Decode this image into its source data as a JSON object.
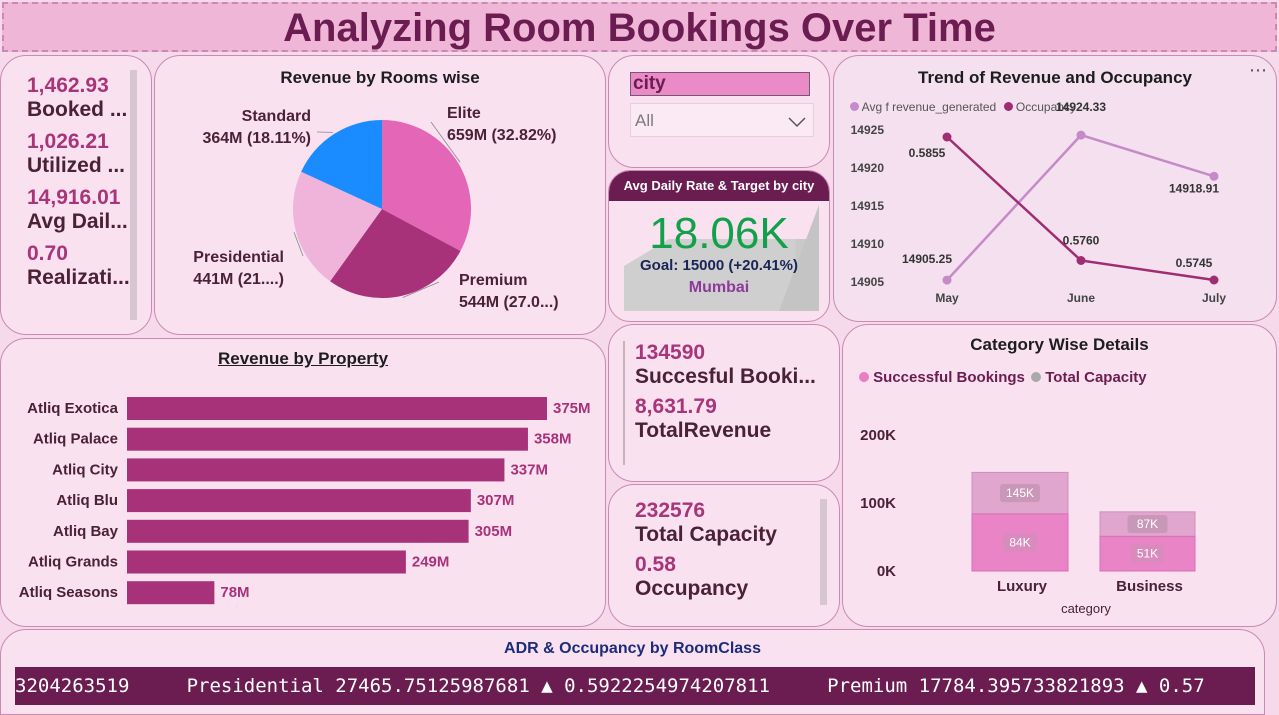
{
  "header": {
    "title": "Analyzing Room Bookings Over Time"
  },
  "kpis_left": [
    {
      "value": "1,462.93",
      "label": "Booked ..."
    },
    {
      "value": "1,026.21",
      "label": "Utilized ..."
    },
    {
      "value": "14,916.01",
      "label": "Avg Dail..."
    },
    {
      "value": "0.70",
      "label": "Realizati..."
    }
  ],
  "rooms_chart": {
    "title": "Revenue by Rooms wise",
    "slices": [
      {
        "name": "Elite",
        "value_label": "659M (32.82%)",
        "value": 659,
        "color": "#e466b7"
      },
      {
        "name": "Premium",
        "value_label": "544M (27.0...)",
        "value": 544,
        "color": "#a8327a"
      },
      {
        "name": "Presidential",
        "value_label": "441M (21....)",
        "value": 441,
        "color": "#f0b4da"
      },
      {
        "name": "Standard",
        "value_label": "364M (18.11%)",
        "value": 364,
        "color": "#1a8cff"
      }
    ]
  },
  "city_filter": {
    "label": "city",
    "selected": "All"
  },
  "gauge": {
    "title": "Avg Daily Rate & Target by city",
    "value": "18.06K",
    "goal": "Goal: 15000 (+20.41%)",
    "city": "Mumbai",
    "fill_fraction": 0.88
  },
  "trend_chart": {
    "title": "Trend of Revenue and Occupancy",
    "legend": [
      {
        "name": "Avg f revenue_generated",
        "color": "#c58bc9"
      },
      {
        "name": "Occupancy",
        "color": "#a02d72"
      }
    ],
    "x": [
      "May",
      "June",
      "July"
    ],
    "y_ticks": [
      "14925",
      "14920",
      "14915",
      "14910",
      "14905"
    ],
    "revenue_labels": [
      "14905.25",
      "14924.33",
      "14918.91"
    ],
    "occupancy_labels": [
      "0.5855",
      "0.5760",
      "0.5745"
    ]
  },
  "property_chart": {
    "title": "Revenue by Property",
    "bars": [
      {
        "name": "Atliq Exotica",
        "label": "375M",
        "value": 375
      },
      {
        "name": "Atliq Palace",
        "label": "358M",
        "value": 358
      },
      {
        "name": "Atliq City",
        "label": "337M",
        "value": 337
      },
      {
        "name": "Atliq Blu",
        "label": "307M",
        "value": 307
      },
      {
        "name": "Atliq Bay",
        "label": "305M",
        "value": 305
      },
      {
        "name": "Atliq Grands",
        "label": "249M",
        "value": 249
      },
      {
        "name": "Atliq Seasons",
        "label": "78M",
        "value": 78
      }
    ]
  },
  "kpis_mid1": [
    {
      "value": "134590",
      "label": "Succesful Booki..."
    },
    {
      "value": "8,631.79",
      "label": "TotalRevenue"
    }
  ],
  "kpis_mid2": [
    {
      "value": "232576",
      "label": "Total Capacity"
    },
    {
      "value": "0.58",
      "label": "Occupancy"
    }
  ],
  "category_chart": {
    "title": "Category Wise Details",
    "legend": [
      {
        "name": "Successful Bookings",
        "color": "#e87fc3"
      },
      {
        "name": "Total Capacity",
        "color": "#a9a9a9"
      }
    ],
    "y_ticks": [
      "200K",
      "100K",
      "0K"
    ],
    "x_title": "category",
    "categories": [
      {
        "name": "Luxury",
        "bookings_label": "84K",
        "capacity_label": "145K",
        "bookings": 84,
        "capacity": 145
      },
      {
        "name": "Business",
        "bookings_label": "51K",
        "capacity_label": "87K",
        "bookings": 51,
        "capacity": 87
      }
    ]
  },
  "ticker": {
    "title": "ADR & Occupancy by RoomClass",
    "text": "3204263519     Presidential 27465.75125987681 ▲ 0.5922254974207811     Premium 17784.395733821893 ▲ 0.57"
  },
  "more_icon": "more-options-icon",
  "chart_data": [
    {
      "type": "pie",
      "title": "Revenue by Rooms wise",
      "categories": [
        "Elite",
        "Premium",
        "Presidential",
        "Standard"
      ],
      "values": [
        659,
        544,
        441,
        364
      ]
    },
    {
      "type": "bar",
      "title": "Revenue by Property",
      "categories": [
        "Atliq Exotica",
        "Atliq Palace",
        "Atliq City",
        "Atliq Blu",
        "Atliq Bay",
        "Atliq Grands",
        "Atliq Seasons"
      ],
      "values": [
        375,
        358,
        337,
        307,
        305,
        249,
        78
      ]
    },
    {
      "type": "line",
      "title": "Trend of Revenue and Occupancy",
      "categories": [
        "May",
        "June",
        "July"
      ],
      "series": [
        {
          "name": "Avg f revenue_generated",
          "values": [
            14905.25,
            14924.33,
            14918.91
          ]
        },
        {
          "name": "Occupancy",
          "values": [
            0.5855,
            0.576,
            0.5745
          ]
        }
      ],
      "ylim": [
        14905,
        14925
      ]
    },
    {
      "type": "bar",
      "title": "Category Wise Details",
      "xlabel": "category",
      "categories": [
        "Luxury",
        "Business"
      ],
      "series": [
        {
          "name": "Successful Bookings",
          "values": [
            84000,
            51000
          ]
        },
        {
          "name": "Total Capacity",
          "values": [
            145000,
            87000
          ]
        }
      ]
    }
  ]
}
